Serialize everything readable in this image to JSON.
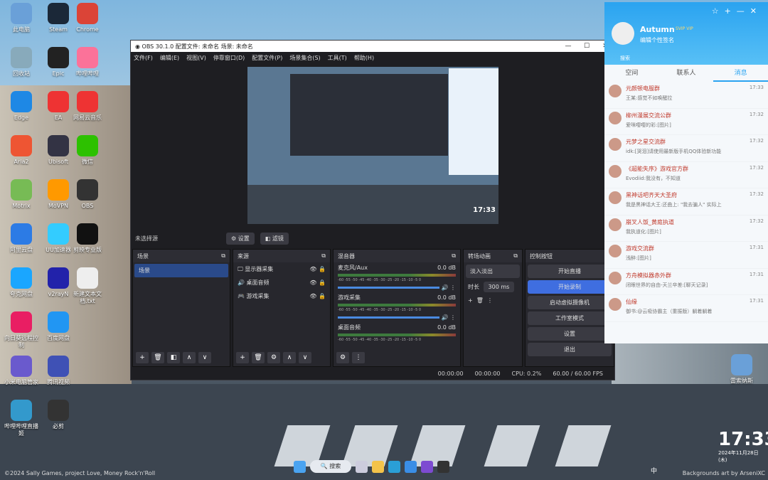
{
  "desktop": {
    "icons": [
      "此电脑",
      "回收站",
      "Edge",
      "Aria2",
      "Motrix",
      "阿里云盘",
      "夸克网盘",
      "向日葵远程控制",
      "小米电脑管家",
      "哔哩哔哩直播姬",
      "Steam",
      "Epic",
      "EA",
      "Ubisoft",
      "MoVPN",
      "UU加速器",
      "v2rayN",
      "百度网盘",
      "腾讯视频",
      "必剪",
      "Chrome",
      "哔哩哔哩",
      "网易云音乐",
      "微信",
      "OBS",
      "剪映专业版",
      "新建文本文档.txt"
    ],
    "right_icon": "雷索纳斯",
    "clock_time": "17:33",
    "clock_date": "2024年11月28日 (木)",
    "credits_left": "©2024 Sally Games, project Love, Money Rock'n'Roll",
    "credits_right": "Backgrounds art by ArseniXC"
  },
  "obs": {
    "title": "OBS 30.1.0   配置文件: 未命名   场景: 未命名",
    "menus": [
      "文件(F)",
      "编辑(E)",
      "视图(V)",
      "停靠窗口(D)",
      "配置文件(P)",
      "场景集合(S)",
      "工具(T)",
      "帮助(H)"
    ],
    "no_source": "未选择源",
    "settings_btn": "设置",
    "filters_btn": "滤镜",
    "preview_clock": "17:33",
    "docks": {
      "scenes": {
        "title": "场景",
        "items": [
          "场景"
        ]
      },
      "sources": {
        "title": "来源",
        "items": [
          "显示器采集",
          "桌面音频",
          "游戏采集"
        ]
      },
      "mixer": {
        "title": "混音器",
        "channels": [
          {
            "name": "麦克风/Aux",
            "db": "0.0 dB"
          },
          {
            "name": "游戏采集",
            "db": "0.0 dB"
          },
          {
            "name": "桌面音频",
            "db": "0.0 dB"
          }
        ],
        "scale": "-60 -55 -50 -45 -40 -35 -30 -25 -20 -15 -10 -5 0"
      },
      "transitions": {
        "title": "转场动画",
        "type": "淡入淡出",
        "duration_label": "时长",
        "duration": "300 ms"
      },
      "controls": {
        "title": "控制按钮",
        "buttons": [
          "开始直播",
          "开始录制",
          "启动虚拟摄像机",
          "工作室模式",
          "设置",
          "退出"
        ]
      }
    },
    "status": {
      "stream_time": "00:00:00",
      "rec_time": "00:00:00",
      "cpu": "CPU: 0.2%",
      "fps": "60.00 / 60.00 FPS"
    },
    "accent": "#2a4a8a"
  },
  "qq": {
    "name": "Autumn",
    "badges": "SVIP VIP",
    "signature": "编辑个性签名",
    "search_placeholder": "搜索",
    "tabs": [
      "空间",
      "联系人",
      "消息"
    ],
    "messages": [
      {
        "name": "元颜顿电服群",
        "msg": "王某:感觉不如唤醒拉",
        "time": "17:33"
      },
      {
        "name": "柳州漫展交流公群",
        "msg": "爱咪嘤嘤的彩:[图片]",
        "time": "17:32"
      },
      {
        "name": "元梦之星交流群",
        "msg": "idk:[哭泪]请使用最新版手机QQ体验新功能",
        "time": "17:32"
      },
      {
        "name": "《超能失序》游戏官方群",
        "msg": "Evodiid:我没有，不知道",
        "time": "17:32"
      },
      {
        "name": "黑神话吧齐天大圣府",
        "msg": "我是黑神话大王:还曲上: \"我去骗人\" 实际上",
        "time": "17:32"
      },
      {
        "name": "崩叉人饭_黄庭执道",
        "msg": "我执道化:[图片]",
        "time": "17:32"
      },
      {
        "name": "游戏交流群",
        "msg": "浅醉:[图片]",
        "time": "17:31"
      },
      {
        "name": "方舟模拟器赤外群",
        "msg": "闭眼世界的自由-天兰卒差:[聊天记录]",
        "time": "17:31"
      },
      {
        "name": "仙缘",
        "msg": "御书:@云吸协霸主（重振版）躺着躺着",
        "time": "17:31"
      }
    ]
  },
  "taskbar": {
    "search": "搜索",
    "ime": "中",
    "tray_time": "17:33"
  }
}
